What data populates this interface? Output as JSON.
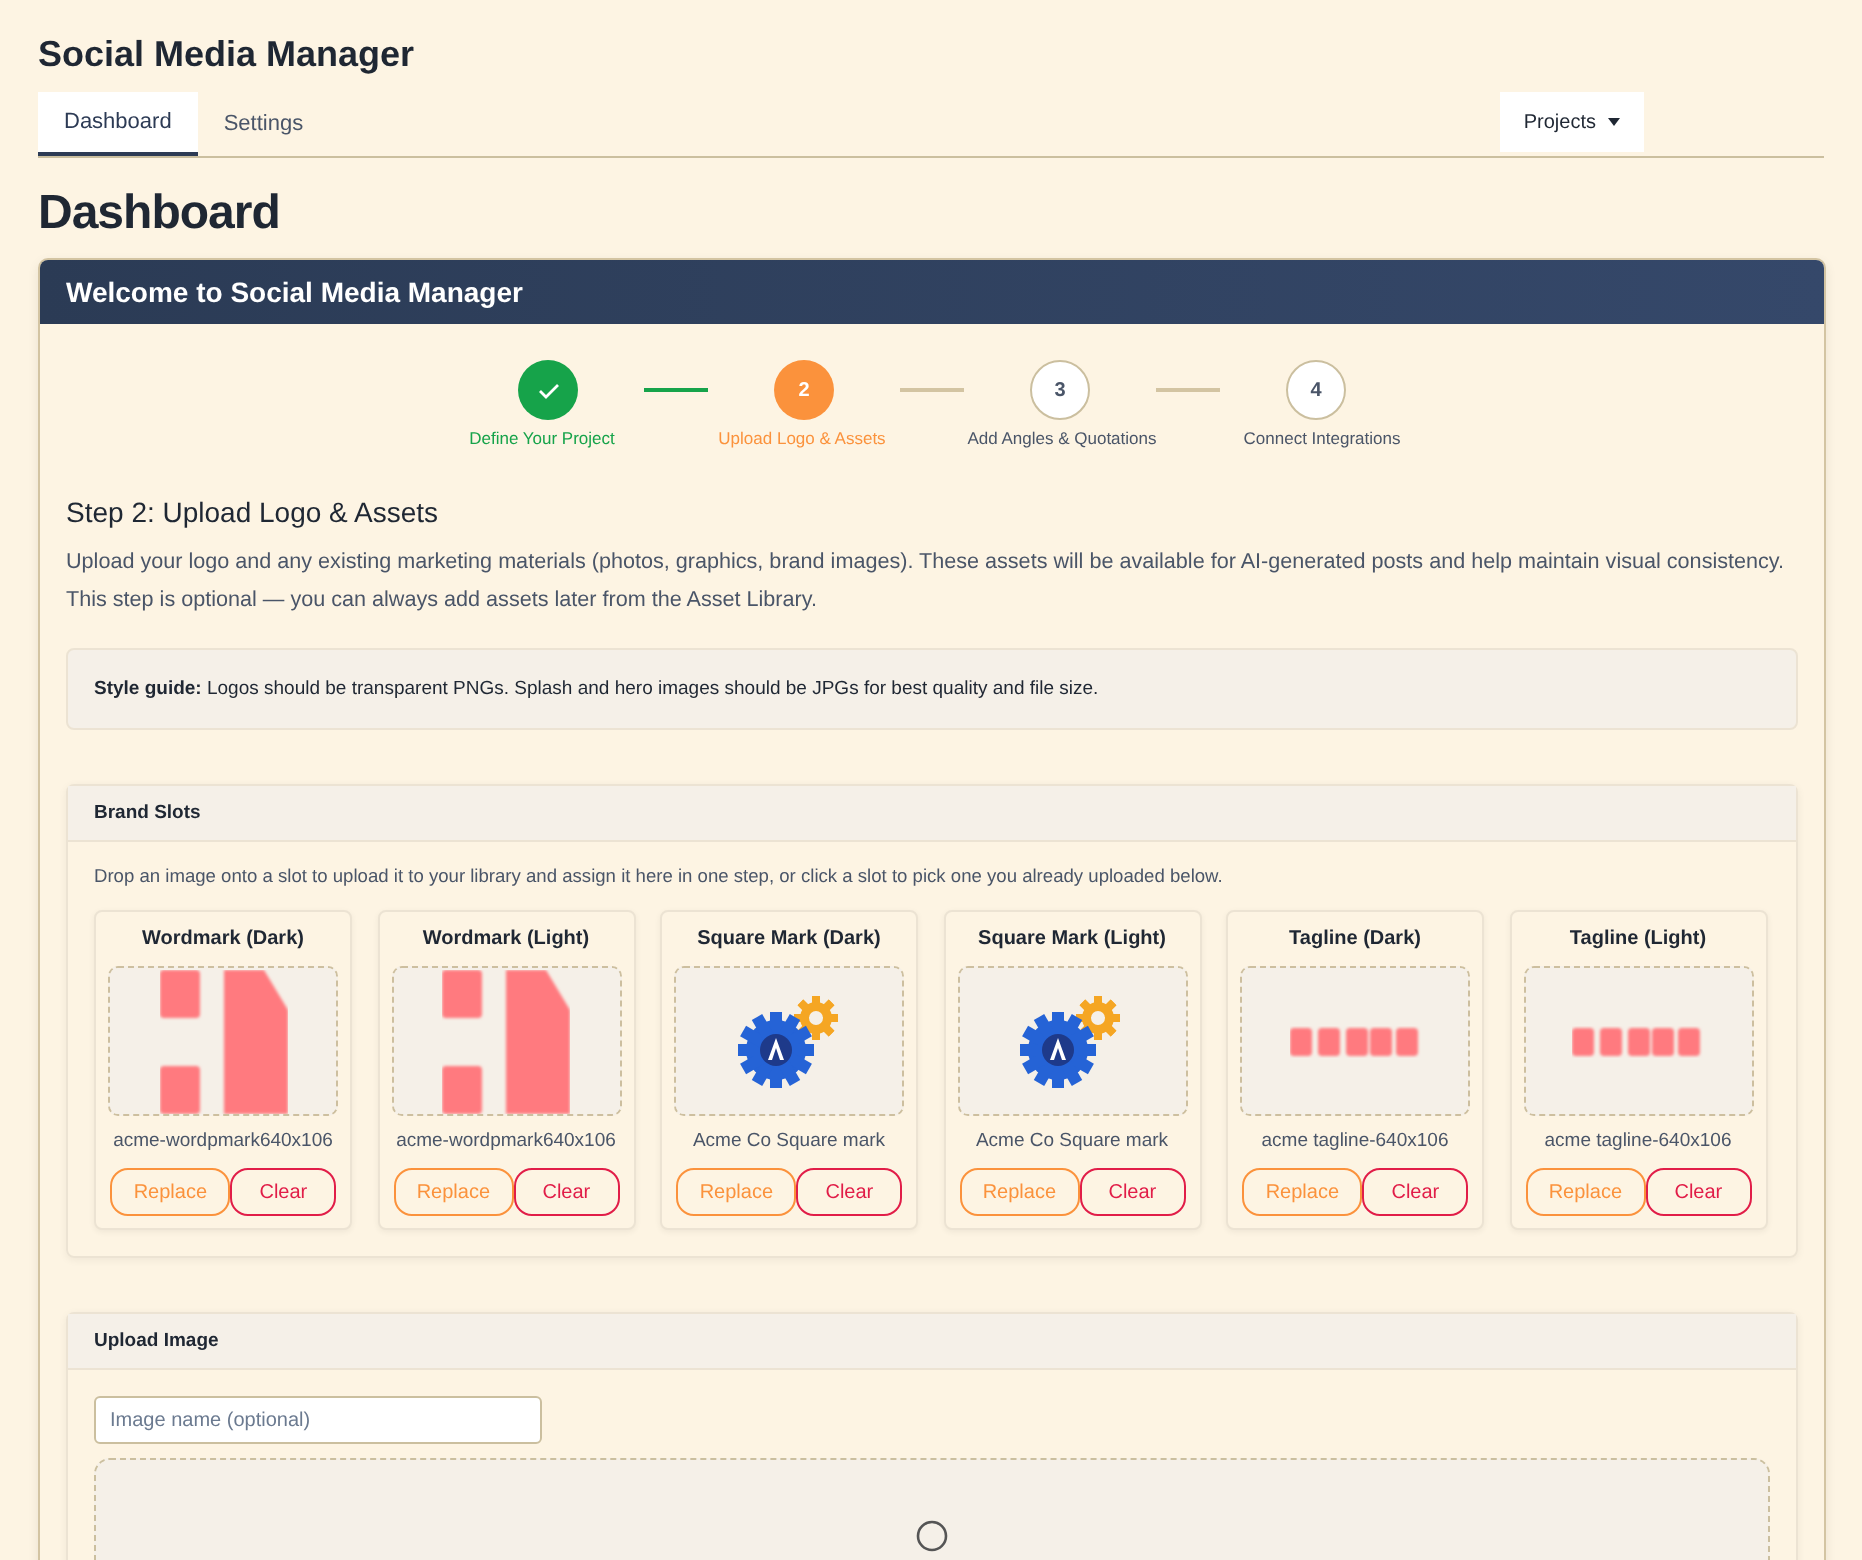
{
  "app_title": "Social Media Manager",
  "tabs": [
    {
      "label": "Dashboard",
      "selected": true
    },
    {
      "label": "Settings",
      "selected": false
    }
  ],
  "projects_button": "Projects",
  "page_title": "Dashboard",
  "welcome_card": {
    "title": "Welcome to Social Media Manager",
    "steps": [
      {
        "label": "Define Your Project",
        "kind": "done"
      },
      {
        "number": "2",
        "label": "Upload Logo & Assets",
        "kind": "active"
      },
      {
        "number": "3",
        "label": "Add Angles & Quotations",
        "kind": "pending"
      },
      {
        "number": "4",
        "label": "Connect Integrations",
        "kind": "pending"
      }
    ],
    "step_heading": "Step 2: Upload Logo & Assets",
    "step_description": "Upload your logo and any existing marketing materials (photos, graphics, brand images). These assets will be available for AI-generated posts and help maintain visual consistency. This step is optional — you can always add assets later from the Asset Library.",
    "style_guide": "**Style guide:** Logos should be transparent PNGs. Splash and hero images should be JPGs for best quality and file size.",
    "brand_slots": {
      "title": "Brand Slots",
      "hint": "Drop an image onto a slot to upload it to your library and assign it here in one step, or click a slot to pick one you already uploaded below.",
      "slots": [
        {
          "title": "Wordmark (Dark)",
          "kind": "wordmark",
          "filename": "acme-wordpmark640x106",
          "replace": "Replace",
          "clear": "Clear"
        },
        {
          "title": "Wordmark (Light)",
          "kind": "wordmark",
          "filename": "acme-wordpmark640x106",
          "replace": "Replace",
          "clear": "Clear"
        },
        {
          "title": "Square Mark (Dark)",
          "kind": "gears",
          "filename": "Acme Co Square mark",
          "replace": "Replace",
          "clear": "Clear"
        },
        {
          "title": "Square Mark (Light)",
          "kind": "gears",
          "filename": "Acme Co Square mark",
          "replace": "Replace",
          "clear": "Clear"
        },
        {
          "title": "Tagline (Dark)",
          "kind": "tagline",
          "filename": "acme tagline-640x106",
          "replace": "Replace",
          "clear": "Clear"
        },
        {
          "title": "Tagline (Light)",
          "kind": "tagline",
          "filename": "acme tagline-640x106",
          "replace": "Replace",
          "clear": "Clear"
        }
      ]
    },
    "upload_image": {
      "title": "Upload Image",
      "name_placeholder": "Image name (optional)"
    }
  }
}
